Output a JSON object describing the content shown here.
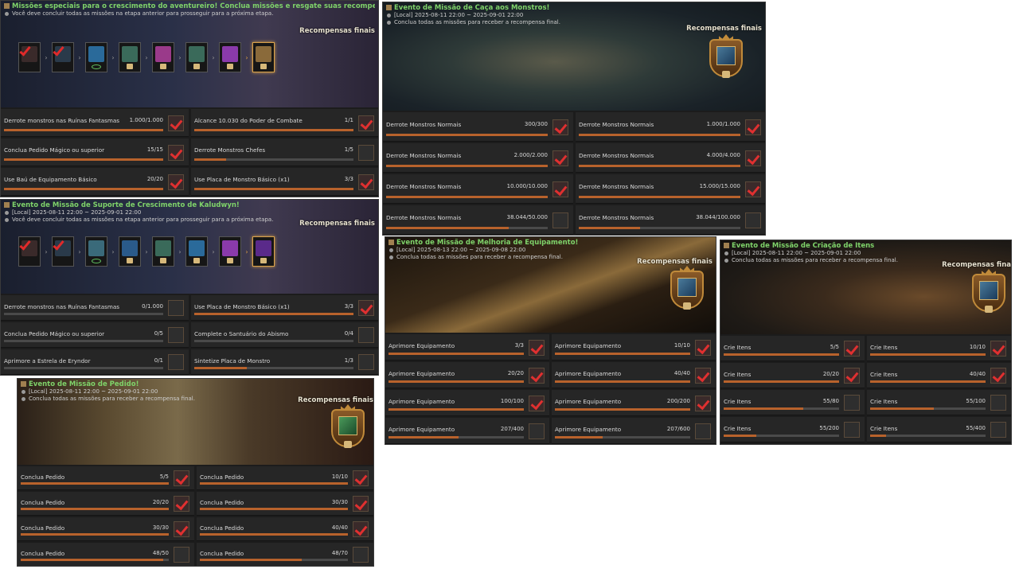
{
  "common": {
    "final_rewards": "Recompensas finais",
    "final_rewards_cut": "Recompensas fina"
  },
  "p1": {
    "title": "Missões especiais para o crescimento do aventureiro! Conclua missões e resgate suas recompensas.",
    "line": "Você deve concluir todas as missões na etapa anterior para prosseguir para a próxima etapa.",
    "rows": [
      {
        "label": "Derrote monstros nas Ruínas Fantasmas",
        "count": "1.000/1.000",
        "p": 1,
        "icon": "check"
      },
      {
        "label": "Alcance 10.030 do Poder de Combate",
        "count": "1/1",
        "p": 1,
        "icon": "check"
      },
      {
        "label": "Conclua Pedido Mágico ou superior",
        "count": "15/15",
        "p": 1,
        "icon": "check"
      },
      {
        "label": "Derrote Monstros Chefes",
        "count": "1/5",
        "p": 0.2,
        "icon": "chest"
      },
      {
        "label": "Use Baú de Equipamento Básico",
        "count": "20/20",
        "p": 1,
        "icon": "check"
      },
      {
        "label": "Use Placa de Monstro Básico (x1)",
        "count": "3/3",
        "p": 1,
        "icon": "check"
      }
    ]
  },
  "p2": {
    "title": "Evento de Missão de Caça aos Monstros!",
    "line1": "[Local] 2025-08-11 22:00 ~ 2025-09-01 22:00",
    "line2": "Conclua todas as missões para receber a recompensa final.",
    "rows": [
      {
        "label": "Derrote Monstros Normais",
        "count": "300/300",
        "p": 1,
        "icon": "check"
      },
      {
        "label": "Derrote Monstros Normais",
        "count": "1.000/1.000",
        "p": 1,
        "icon": "check"
      },
      {
        "label": "Derrote Monstros Normais",
        "count": "2.000/2.000",
        "p": 1,
        "icon": "check"
      },
      {
        "label": "Derrote Monstros Normais",
        "count": "4.000/4.000",
        "p": 1,
        "icon": "check"
      },
      {
        "label": "Derrote Monstros Normais",
        "count": "10.000/10.000",
        "p": 1,
        "icon": "check"
      },
      {
        "label": "Derrote Monstros Normais",
        "count": "15.000/15.000",
        "p": 1,
        "icon": "check"
      },
      {
        "label": "Derrote Monstros Normais",
        "count": "38.044/50.000",
        "p": 0.76,
        "icon": "dark"
      },
      {
        "label": "Derrote Monstros Normais",
        "count": "38.044/100.000",
        "p": 0.38,
        "icon": "dark"
      }
    ]
  },
  "p3": {
    "title": "Evento de Missão de Suporte de Crescimento de Kaludwyn!",
    "line1": "[Local] 2025-08-11 22:00 ~ 2025-09-01 22:00",
    "line2": "Você deve concluir todas as missões na etapa anterior para prosseguir para a próxima etapa.",
    "rows": [
      {
        "label": "Derrote monstros nas Ruínas Fantasmas",
        "count": "0/1.000",
        "p": 0,
        "icon": "dark"
      },
      {
        "label": "Use Placa de Monstro Básico (x1)",
        "count": "3/3",
        "p": 1,
        "icon": "check"
      },
      {
        "label": "Conclua Pedido Mágico ou superior",
        "count": "0/5",
        "p": 0,
        "icon": "dark"
      },
      {
        "label": "Complete o Santuário do Abismo",
        "count": "0/4",
        "p": 0,
        "icon": "dark"
      },
      {
        "label": "Aprimore a Estrela de Eryndor",
        "count": "0/1",
        "p": 0,
        "icon": "dark"
      },
      {
        "label": "Sintetize Placa de Monstro",
        "count": "1/3",
        "p": 0.33,
        "icon": "dark"
      }
    ]
  },
  "p4": {
    "title": "Evento de Missão de Melhoria de Equipamento!",
    "line1": "[Local] 2025-08-13 22:00 ~ 2025-09-08 22:00",
    "line2": "Conclua todas as missões para receber a recompensa final.",
    "rows": [
      {
        "label": "Aprimore Equipamento",
        "count": "3/3",
        "p": 1,
        "icon": "check"
      },
      {
        "label": "Aprimore Equipamento",
        "count": "10/10",
        "p": 1,
        "icon": "check"
      },
      {
        "label": "Aprimore Equipamento",
        "count": "20/20",
        "p": 1,
        "icon": "check"
      },
      {
        "label": "Aprimore Equipamento",
        "count": "40/40",
        "p": 1,
        "icon": "check"
      },
      {
        "label": "Aprimore Equipamento",
        "count": "100/100",
        "p": 1,
        "icon": "check"
      },
      {
        "label": "Aprimore Equipamento",
        "count": "200/200",
        "p": 1,
        "icon": "check"
      },
      {
        "label": "Aprimore Equipamento",
        "count": "207/400",
        "p": 0.52,
        "icon": "dark"
      },
      {
        "label": "Aprimore Equipamento",
        "count": "207/600",
        "p": 0.35,
        "icon": "dark"
      }
    ]
  },
  "p5": {
    "title": "Evento de Missão de Criação de Itens",
    "line1": "[Local] 2025-08-11 22:00 ~ 2025-09-01 22:00",
    "line2": "Conclua todas as missões para receber a recompensa final.",
    "rows": [
      {
        "label": "Crie Itens",
        "count": "5/5",
        "p": 1,
        "icon": "check"
      },
      {
        "label": "Crie Itens",
        "count": "10/10",
        "p": 1,
        "icon": "check"
      },
      {
        "label": "Crie Itens",
        "count": "20/20",
        "p": 1,
        "icon": "check"
      },
      {
        "label": "Crie Itens",
        "count": "40/40",
        "p": 1,
        "icon": "check"
      },
      {
        "label": "Crie Itens",
        "count": "55/80",
        "p": 0.69,
        "icon": "dark"
      },
      {
        "label": "Crie Itens",
        "count": "55/100",
        "p": 0.55,
        "icon": "dark"
      },
      {
        "label": "Crie Itens",
        "count": "55/200",
        "p": 0.28,
        "icon": "dark"
      },
      {
        "label": "Crie Itens",
        "count": "55/400",
        "p": 0.14,
        "icon": "dark"
      }
    ]
  },
  "p6": {
    "title": "Evento de Missão de Pedido!",
    "line1": "[Local] 2025-08-11 22:00 ~ 2025-09-01 22:00",
    "line2": "Conclua todas as missões para receber a recompensa final.",
    "rows": [
      {
        "label": "Conclua Pedido",
        "count": "5/5",
        "p": 1,
        "icon": "check"
      },
      {
        "label": "Conclua Pedido",
        "count": "10/10",
        "p": 1,
        "icon": "check"
      },
      {
        "label": "Conclua Pedido",
        "count": "20/20",
        "p": 1,
        "icon": "check"
      },
      {
        "label": "Conclua Pedido",
        "count": "30/30",
        "p": 1,
        "icon": "check"
      },
      {
        "label": "Conclua Pedido",
        "count": "30/30",
        "p": 1,
        "icon": "check"
      },
      {
        "label": "Conclua Pedido",
        "count": "40/40",
        "p": 1,
        "icon": "check"
      },
      {
        "label": "Conclua Pedido",
        "count": "48/50",
        "p": 0.96,
        "icon": "dark"
      },
      {
        "label": "Conclua Pedido",
        "count": "48/70",
        "p": 0.69,
        "icon": "dark"
      }
    ]
  }
}
